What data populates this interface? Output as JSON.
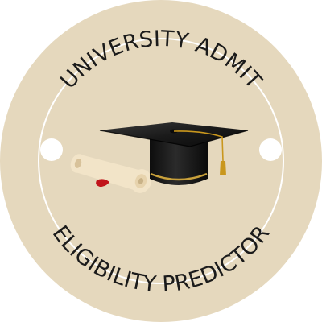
{
  "badge": {
    "title_top": "UNIVERSITY ADMIT",
    "title_bottom": "ELIGIBILITY PREDICTOR",
    "icons": {
      "main": "graduation-cap-icon",
      "secondary": "diploma-scroll-icon"
    },
    "colors": {
      "background": "#ffffff",
      "disc": "#e5d8bd",
      "ring_line": "#ffffff",
      "text": "#1b1b1b",
      "cap": "#151515",
      "cap_band": "#c9a13b",
      "tassel": "#c9971d",
      "scroll": "#f2e4c8",
      "seal": "#c1141b"
    }
  }
}
